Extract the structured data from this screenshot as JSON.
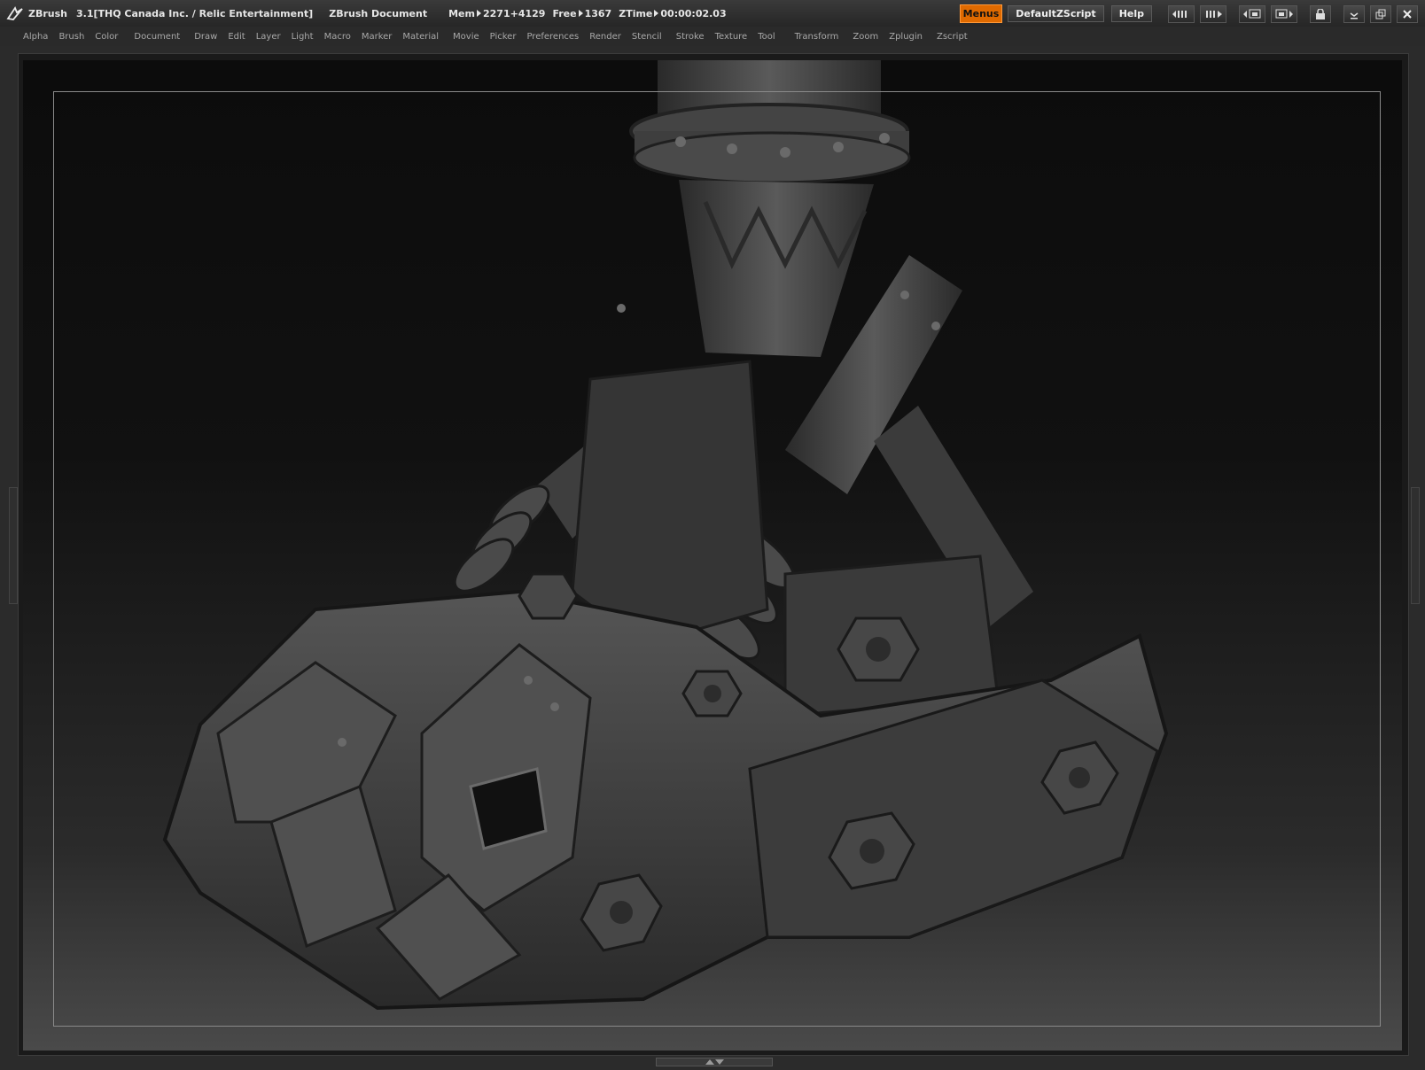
{
  "title": {
    "app": "ZBrush",
    "version": "3.1[THQ Canada Inc. / Relic Entertainment]",
    "document": "ZBrush Document",
    "mem_label": "Mem",
    "mem_value": "2271+4129",
    "free_label": "Free",
    "free_value": "1367",
    "ztime_label": "ZTime",
    "ztime_value": "00:00:02.03"
  },
  "toolbar": {
    "menus_label": "Menus",
    "script_label": "DefaultZScript",
    "help_label": "Help"
  },
  "menu": [
    "Alpha",
    "Brush",
    "Color",
    "Document",
    "Draw",
    "Edit",
    "Layer",
    "Light",
    "Macro",
    "Marker",
    "Material",
    "Movie",
    "Picker",
    "Preferences",
    "Render",
    "Stencil",
    "Stroke",
    "Texture",
    "Tool",
    "Transform",
    "Zoom",
    "Zplugin",
    "Zscript"
  ],
  "colors": {
    "accent": "#e06a00",
    "background": "#2b2b2b",
    "canvas_top": "#0c0c0c",
    "canvas_bottom": "#4a4a4a"
  },
  "icons": [
    "zbrush-logo-icon",
    "scroll-left-icon",
    "scroll-right-icon",
    "palette-left-icon",
    "palette-right-icon",
    "lock-icon",
    "minimize-icon",
    "restore-icon",
    "close-icon"
  ]
}
